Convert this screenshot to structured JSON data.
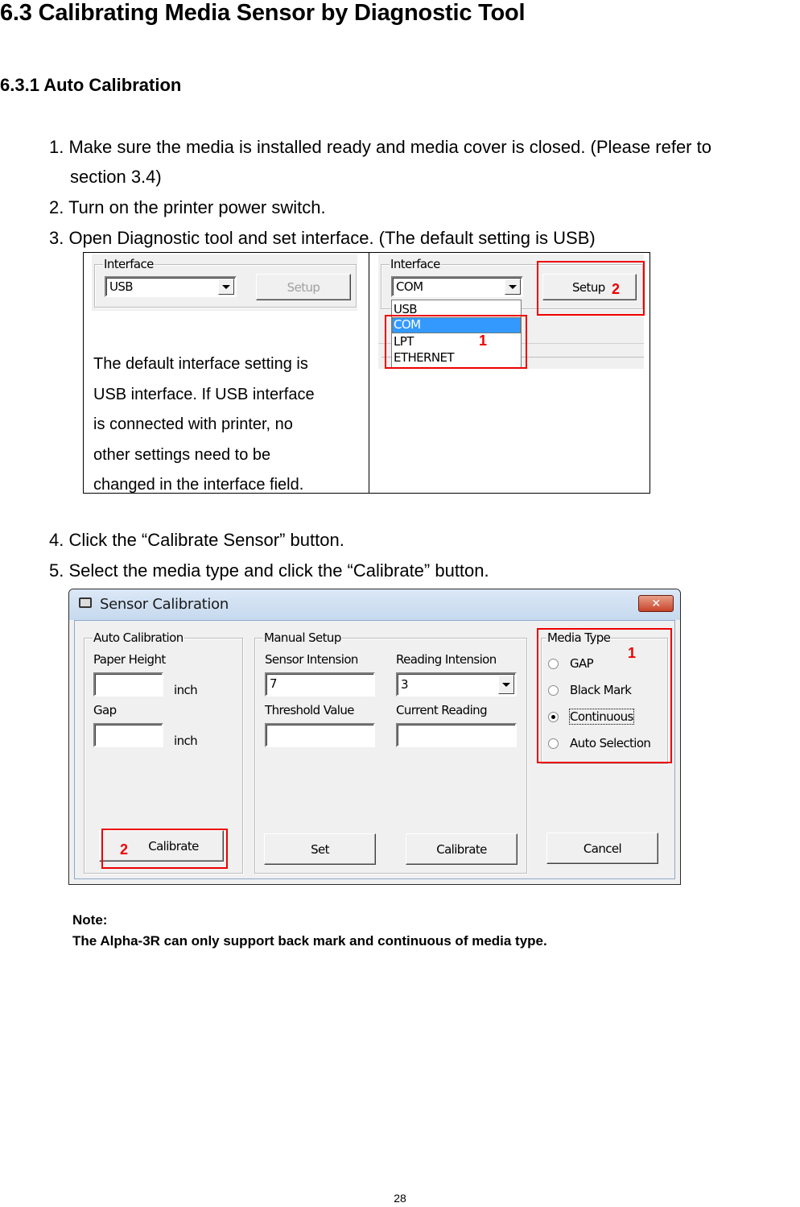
{
  "heading": "6.3 Calibrating Media Sensor by Diagnostic Tool",
  "subheading": "6.3.1 Auto Calibration",
  "steps": [
    "1. Make sure the media is installed ready and media cover is closed. (Please refer to",
    "section 3.4)",
    "2. Turn on the printer power switch.",
    "3. Open Diagnostic tool and set interface. (The default setting is USB)",
    "4. Click the “Calibrate Sensor” button.",
    "5. Select the media type and click the “Calibrate” button."
  ],
  "interface_table": {
    "left": {
      "group_title": "Interface",
      "combo_value": "USB",
      "setup_label": "Setup",
      "description_lines": [
        "The default interface setting is",
        "USB interface. If USB interface",
        "is connected with printer, no",
        "other settings need to be",
        "changed in the interface field."
      ]
    },
    "right": {
      "group_title": "Interface",
      "combo_value": "COM",
      "setup_label": "Setup",
      "dropdown_options": [
        "USB",
        "COM",
        "LPT",
        "ETHERNET"
      ],
      "selected_option": "COM",
      "callout_1": "1",
      "callout_2": "2"
    }
  },
  "dialog": {
    "title": "Sensor Calibration",
    "close_label": "x",
    "auto_calibration": {
      "title": "Auto Calibration",
      "paper_height_label": "Paper Height",
      "paper_height_value": "",
      "paper_height_unit": "inch",
      "gap_label": "Gap",
      "gap_value": "",
      "gap_unit": "inch",
      "calibrate_label": "Calibrate",
      "callout": "2"
    },
    "manual_setup": {
      "title": "Manual Setup",
      "sensor_intension_label": "Sensor Intension",
      "sensor_intension_value": "7",
      "reading_intension_label": "Reading Intension",
      "reading_intension_value": "3",
      "threshold_label": "Threshold Value",
      "threshold_value": "",
      "current_reading_label": "Current Reading",
      "current_reading_value": "",
      "set_label": "Set",
      "calibrate_label": "Calibrate"
    },
    "media_type": {
      "title": "Media Type",
      "options": [
        "GAP",
        "Black Mark",
        "Continuous",
        "Auto Selection"
      ],
      "selected": "Continuous",
      "callout": "1"
    },
    "cancel_label": "Cancel"
  },
  "note": {
    "title": "Note:",
    "text": "The Alpha-3R can only support back mark and continuous of media type."
  },
  "page_number": "28",
  "colors": {
    "callout": "#e00000",
    "selection": "#3399ff"
  }
}
